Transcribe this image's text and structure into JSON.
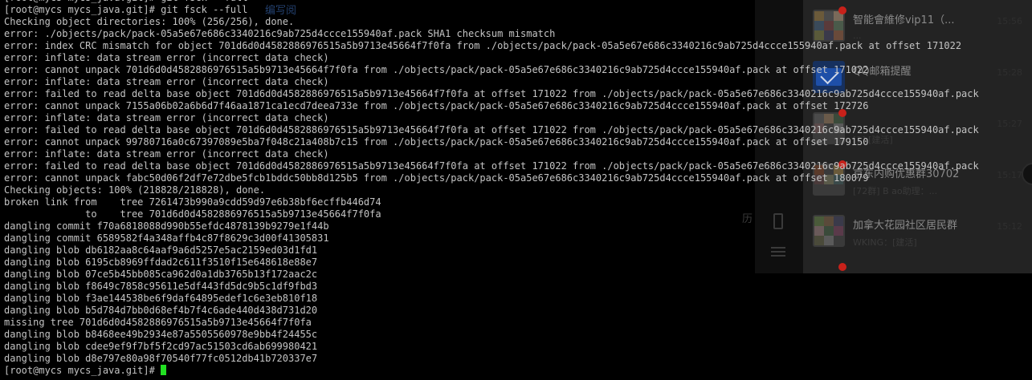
{
  "background_app": {
    "link_text": "编写阅",
    "history_text": "历",
    "chats": [
      {
        "name": "智能會維修vip11（...",
        "preview": "...",
        "time": "15:56",
        "avatar": "group"
      },
      {
        "name": "QQ邮箱提醒",
        "preview": "",
        "time": "15:28",
        "avatar": "mail"
      },
      {
        "name": "",
        "preview": "[1] [建活]",
        "time": "15:27",
        "avatar": "group"
      },
      {
        "name": "京东内购优惠群30702",
        "preview": "[72群] B ao助理：...",
        "time": "15:17",
        "avatar": "group"
      },
      {
        "name": "加拿大花园社区居民群",
        "preview": "WKING：[建活]",
        "time": "15:12",
        "avatar": "group"
      }
    ]
  },
  "terminal": {
    "lines": [
      "[root@mycs mycs_java.git]# git fsck --full",
      "[root@mycs mycs_java.git]# git fsck --full",
      "Checking object directories: 100% (256/256), done.",
      "error: ./objects/pack/pack-05a5e67e686c3340216c9ab725d4ccce155940af.pack SHA1 checksum mismatch",
      "error: index CRC mismatch for object 701d6d0d4582886976515a5b9713e45664f7f0fa from ./objects/pack/pack-05a5e67e686c3340216c9ab725d4ccce155940af.pack at offset 171022",
      "error: inflate: data stream error (incorrect data check)",
      "error: cannot unpack 701d6d0d4582886976515a5b9713e45664f7f0fa from ./objects/pack/pack-05a5e67e686c3340216c9ab725d4ccce155940af.pack at offset 171022",
      "error: inflate: data stream error (incorrect data check)",
      "error: failed to read delta base object 701d6d0d4582886976515a5b9713e45664f7f0fa at offset 171022 from ./objects/pack/pack-05a5e67e686c3340216c9ab725d4ccce155940af.pack",
      "error: cannot unpack 7155a06b02a6b6d7f46aa1871ca1ecd7deea733e from ./objects/pack/pack-05a5e67e686c3340216c9ab725d4ccce155940af.pack at offset 172726",
      "error: inflate: data stream error (incorrect data check)",
      "error: failed to read delta base object 701d6d0d4582886976515a5b9713e45664f7f0fa at offset 171022 from ./objects/pack/pack-05a5e67e686c3340216c9ab725d4ccce155940af.pack",
      "error: cannot unpack 99780716a0c67397089e5ba7f048c21a408b7c15 from ./objects/pack/pack-05a5e67e686c3340216c9ab725d4ccce155940af.pack at offset 179150",
      "error: inflate: data stream error (incorrect data check)",
      "error: failed to read delta base object 701d6d0d4582886976515a5b9713e45664f7f0fa at offset 171022 from ./objects/pack/pack-05a5e67e686c3340216c9ab725d4ccce155940af.pack",
      "error: cannot unpack fabc50d06f2df7e72dbe5fcb1bddc50bb8d125b5 from ./objects/pack/pack-05a5e67e686c3340216c9ab725d4ccce155940af.pack at offset 180079",
      "Checking objects: 100% (218828/218828), done.",
      "broken link from    tree 7261473b990a9cdd59d97e6b38bf6ecffb446d74",
      "              to    tree 701d6d0d4582886976515a5b9713e45664f7f0fa",
      "dangling commit f70a6818088d990b55efdc4878139b9279e1f44b",
      "dangling commit 6589582f4a348affb4c87f8629c3d00f41305831",
      "dangling blob db6182aa8c64aaf9a6d5257e5ac2159ed03d1fd1",
      "dangling blob 6195cb8969ffdad2c611f3510f15e648618e88e7",
      "dangling blob 07ce5b45bb085ca962d0a1db3765b13f172aac2c",
      "dangling blob f8649c7858c95611e5df443fd5dc9b5c1df9fbd3",
      "dangling blob f3ae144538be6f9daf64895edef1c6e3eb810f18",
      "dangling blob b5d784d7bb0d68ef4b7f4c6ade440d438d731d20",
      "missing tree 701d6d0d4582886976515a5b9713e45664f7f0fa",
      "dangling blob b8468ee49b2934e87a5505560978e9bb4f24455c",
      "dangling blob cdee9ef9f7bf5f2cd97ac51503cd6ab699980421",
      "dangling blob d8e797e80a98f70540f77fc0512db41b720337e7"
    ],
    "prompt": "[root@mycs mycs_java.git]# ",
    "cursor_color": "#22e022",
    "text_color": "#c4c4c4",
    "background_color": "#000000"
  }
}
